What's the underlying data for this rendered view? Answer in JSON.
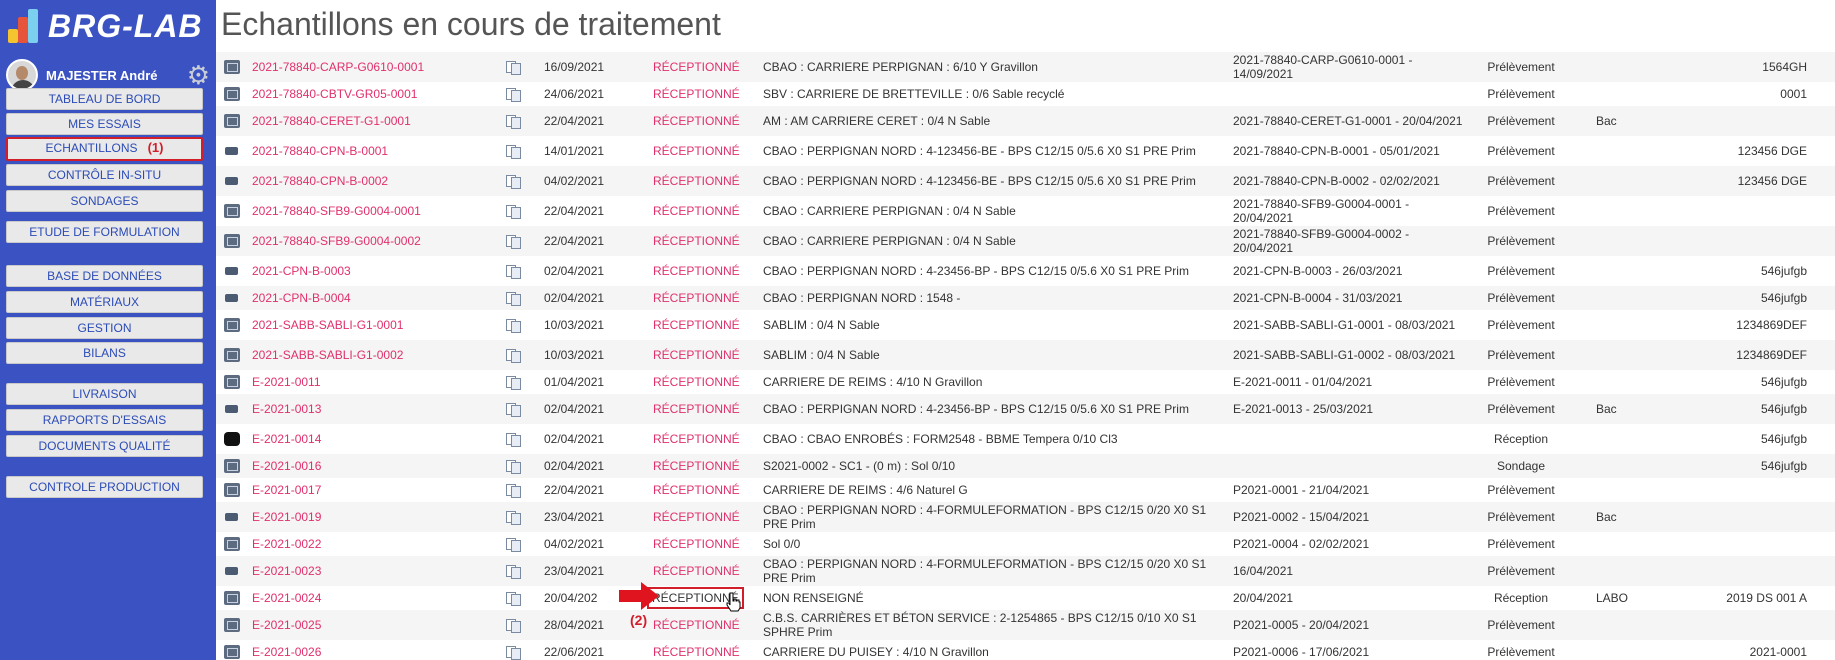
{
  "app": {
    "logo_text": "BRG-LAB",
    "page_title": "Echantillons en cours de traitement"
  },
  "user": {
    "name": "MAJESTER André"
  },
  "nav": {
    "tableau_de_bord": "TABLEAU DE BORD",
    "mes_essais": "MES ESSAIS",
    "echantillons": "ECHANTILLONS",
    "echantillons_tag": "(1)",
    "controle_in_situ": "CONTRÔLE IN-SITU",
    "sondages": "SONDAGES",
    "etude_formulation": "ETUDE DE FORMULATION",
    "base_donnees": "BASE DE DONNÉES",
    "materiaux": "MATÉRIAUX",
    "gestion": "GESTION",
    "bilans": "BILANS",
    "livraison": "LIVRAISON",
    "rapports_essais": "RAPPORTS D'ESSAIS",
    "documents_qualite": "DOCUMENTS QUALITÉ",
    "controle_production": "CONTROLE PRODUCTION"
  },
  "annotations": {
    "step2": "(2)"
  },
  "colors": {
    "sidebar": "#3a52c2",
    "link": "#e0306b",
    "highlight": "#d21e2b"
  },
  "rows": [
    {
      "icon": "sample",
      "code": "2021-78840-CARP-G0610-0001",
      "date": "16/09/2021",
      "status": "RÉCEPTIONNÉ",
      "desc": "CBAO : CARRIERE PERPIGNAN : 6/10 Y Gravillon",
      "ref": "2021-78840-CARP-G0610-0001 - 14/09/2021",
      "type": "Prélèvement",
      "container": "",
      "num": "1564GH"
    },
    {
      "icon": "sample",
      "code": "2021-78840-CBTV-GR05-0001",
      "date": "24/06/2021",
      "status": "RÉCEPTIONNÉ",
      "desc": "SBV : CARRIERE DE BRETTEVILLE : 0/6 Sable recyclé",
      "ref": "",
      "type": "Prélèvement",
      "container": "",
      "num": "0001"
    },
    {
      "icon": "sample",
      "code": "2021-78840-CERET-G1-0001",
      "date": "22/04/2021",
      "status": "RÉCEPTIONNÉ",
      "desc": "AM : AM CARRIERE CERET : 0/4 N Sable",
      "ref": "2021-78840-CERET-G1-0001 - 20/04/2021",
      "type": "Prélèvement",
      "container": "Bac",
      "num": ""
    },
    {
      "icon": "truck",
      "code": "2021-78840-CPN-B-0001",
      "date": "14/01/2021",
      "status": "RÉCEPTIONNÉ",
      "desc": "CBAO : PERPIGNAN NORD : 4-123456-BE - BPS C12/15 0/5.6 X0 S1 PRE Prim",
      "ref": "2021-78840-CPN-B-0001 - 05/01/2021",
      "type": "Prélèvement",
      "container": "",
      "num": "123456 DGE"
    },
    {
      "icon": "truck",
      "code": "2021-78840-CPN-B-0002",
      "date": "04/02/2021",
      "status": "RÉCEPTIONNÉ",
      "desc": "CBAO : PERPIGNAN NORD : 4-123456-BE - BPS C12/15 0/5.6 X0 S1 PRE Prim",
      "ref": "2021-78840-CPN-B-0002 - 02/02/2021",
      "type": "Prélèvement",
      "container": "",
      "num": "123456 DGE"
    },
    {
      "icon": "sample",
      "code": "2021-78840-SFB9-G0004-0001",
      "date": "22/04/2021",
      "status": "RÉCEPTIONNÉ",
      "desc": "CBAO : CARRIERE PERPIGNAN : 0/4 N Sable",
      "ref": "2021-78840-SFB9-G0004-0001 - 20/04/2021",
      "type": "Prélèvement",
      "container": "",
      "num": ""
    },
    {
      "icon": "sample",
      "code": "2021-78840-SFB9-G0004-0002",
      "date": "22/04/2021",
      "status": "RÉCEPTIONNÉ",
      "desc": "CBAO : CARRIERE PERPIGNAN : 0/4 N Sable",
      "ref": "2021-78840-SFB9-G0004-0002 - 20/04/2021",
      "type": "Prélèvement",
      "container": "",
      "num": ""
    },
    {
      "icon": "truck",
      "code": "2021-CPN-B-0003",
      "date": "02/04/2021",
      "status": "RÉCEPTIONNÉ",
      "desc": "CBAO : PERPIGNAN NORD : 4-23456-BP - BPS C12/15 0/5.6 X0 S1 PRE Prim",
      "ref": "2021-CPN-B-0003 - 26/03/2021",
      "type": "Prélèvement",
      "container": "",
      "num": "546jufgb"
    },
    {
      "icon": "truck",
      "code": "2021-CPN-B-0004",
      "date": "02/04/2021",
      "status": "RÉCEPTIONNÉ",
      "desc": "CBAO : PERPIGNAN NORD : 1548 -",
      "ref": "2021-CPN-B-0004 - 31/03/2021",
      "type": "Prélèvement",
      "container": "",
      "num": "546jufgb"
    },
    {
      "icon": "sample",
      "code": "2021-SABB-SABLI-G1-0001",
      "date": "10/03/2021",
      "status": "RÉCEPTIONNÉ",
      "desc": "SABLIM : 0/4 N Sable",
      "ref": "2021-SABB-SABLI-G1-0001 - 08/03/2021",
      "type": "Prélèvement",
      "container": "",
      "num": "1234869DEF"
    },
    {
      "icon": "sample",
      "code": "2021-SABB-SABLI-G1-0002",
      "date": "10/03/2021",
      "status": "RÉCEPTIONNÉ",
      "desc": "SABLIM : 0/4 N Sable",
      "ref": "2021-SABB-SABLI-G1-0002 - 08/03/2021",
      "type": "Prélèvement",
      "container": "",
      "num": "1234869DEF"
    },
    {
      "icon": "sample",
      "code": "E-2021-0011",
      "date": "01/04/2021",
      "status": "RÉCEPTIONNÉ",
      "desc": "CARRIERE DE REIMS : 4/10 N Gravillon",
      "ref": "E-2021-0011 - 01/04/2021",
      "type": "Prélèvement",
      "container": "",
      "num": "546jufgb"
    },
    {
      "icon": "truck",
      "code": "E-2021-0013",
      "date": "02/04/2021",
      "status": "RÉCEPTIONNÉ",
      "desc": "CBAO : PERPIGNAN NORD : 4-23456-BP - BPS C12/15 0/5.6 X0 S1 PRE Prim",
      "ref": "E-2021-0013 - 25/03/2021",
      "type": "Prélèvement",
      "container": "Bac",
      "num": "546jufgb"
    },
    {
      "icon": "black",
      "code": "E-2021-0014",
      "date": "02/04/2021",
      "status": "RÉCEPTIONNÉ",
      "desc": "CBAO : CBAO ENROBÉS : FORM2548 - BBME Tempera 0/10 Cl3",
      "ref": "",
      "type": "Réception",
      "container": "",
      "num": "546jufgb"
    },
    {
      "icon": "sample",
      "code": "E-2021-0016",
      "date": "02/04/2021",
      "status": "RÉCEPTIONNÉ",
      "desc": "S2021-0002 - SC1 - (0 m) : Sol 0/10",
      "ref": "",
      "type": "Sondage",
      "container": "",
      "num": "546jufgb"
    },
    {
      "icon": "sample",
      "code": "E-2021-0017",
      "date": "22/04/2021",
      "status": "RÉCEPTIONNÉ",
      "desc": "CARRIERE DE REIMS : 4/6 Naturel G",
      "ref": "P2021-0001 - 21/04/2021",
      "type": "Prélèvement",
      "container": "",
      "num": ""
    },
    {
      "icon": "truck",
      "code": "E-2021-0019",
      "date": "23/04/2021",
      "status": "RÉCEPTIONNÉ",
      "desc": "CBAO : PERPIGNAN NORD : 4-FORMULEFORMATION - BPS C12/15 0/20 X0 S1 PRE Prim",
      "ref": "P2021-0002 - 15/04/2021",
      "type": "Prélèvement",
      "container": "Bac",
      "num": ""
    },
    {
      "icon": "sample",
      "code": "E-2021-0022",
      "date": "04/02/2021",
      "status": "RÉCEPTIONNÉ",
      "desc": "Sol 0/0",
      "ref": "P2021-0004 - 02/02/2021",
      "type": "Prélèvement",
      "container": "",
      "num": ""
    },
    {
      "icon": "truck",
      "code": "E-2021-0023",
      "date": "23/04/2021",
      "status": "RÉCEPTIONNÉ",
      "desc": "CBAO : PERPIGNAN NORD : 4-FORMULEFORMATION - BPS C12/15 0/20 X0 S1 PRE Prim",
      "ref": "16/04/2021",
      "type": "Prélèvement",
      "container": "",
      "num": ""
    },
    {
      "icon": "sample",
      "code": "E-2021-0024",
      "date": "20/04/202",
      "status": "RÉCEPTIONNÉ",
      "desc": "NON RENSEIGNÉ",
      "ref": "20/04/2021",
      "type": "Réception",
      "container": "LABO",
      "num": "2019 DS 001 A"
    },
    {
      "icon": "sample",
      "code": "E-2021-0025",
      "date": "28/04/2021",
      "status": "RÉCEPTIONNÉ",
      "desc": "C.B.S. CARRIÈRES ET BÉTON SERVICE : 2-1254865 - BPS C12/15 0/10 X0 S1 SPHRE Prim",
      "ref": "P2021-0005 - 20/04/2021",
      "type": "Prélèvement",
      "container": "",
      "num": ""
    },
    {
      "icon": "sample",
      "code": "E-2021-0026",
      "date": "22/06/2021",
      "status": "RÉCEPTIONNÉ",
      "desc": "CARRIERE DU PUISEY : 4/10 N Gravillon",
      "ref": "P2021-0006 - 17/06/2021",
      "type": "Prélèvement",
      "container": "",
      "num": "2021-0001"
    }
  ]
}
